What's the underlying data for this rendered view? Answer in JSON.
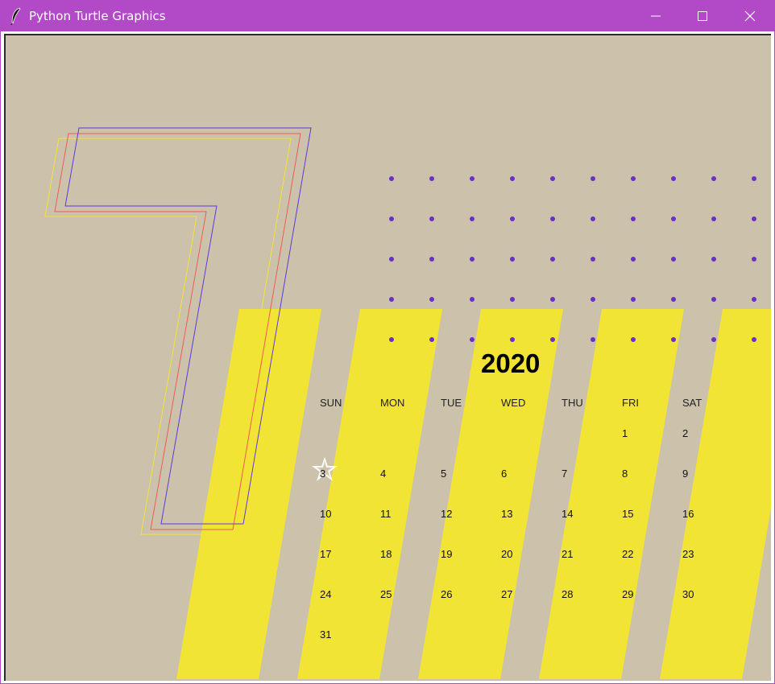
{
  "window": {
    "title": "Python Turtle Graphics",
    "icon": "feather-icon",
    "controls": [
      "minimize-icon",
      "maximize-icon",
      "close-icon"
    ]
  },
  "colors": {
    "titlebar": "#b249c7",
    "canvas_bg": "#ccc2ac",
    "stripes": "#f2e434",
    "dots": "#6a2fc4",
    "outline_yellow": "#f2e434",
    "outline_red": "#ef5b52",
    "outline_blue": "#5b3ad9",
    "turtle": "#ffffff"
  },
  "calendar": {
    "year": "2020",
    "big_numeral": "7",
    "weekdays": [
      "SUN",
      "MON",
      "TUE",
      "WED",
      "THU",
      "FRI",
      "SAT"
    ],
    "weeks": [
      [
        "",
        "",
        "",
        "",
        "",
        "1",
        "2"
      ],
      [
        "3",
        "4",
        "5",
        "6",
        "7",
        "8",
        "9"
      ],
      [
        "10",
        "11",
        "12",
        "13",
        "14",
        "15",
        "16"
      ],
      [
        "17",
        "18",
        "19",
        "20",
        "21",
        "22",
        "23"
      ],
      [
        "24",
        "25",
        "26",
        "27",
        "28",
        "29",
        "30"
      ],
      [
        "31",
        "",
        "",
        "",
        "",
        "",
        ""
      ]
    ]
  }
}
